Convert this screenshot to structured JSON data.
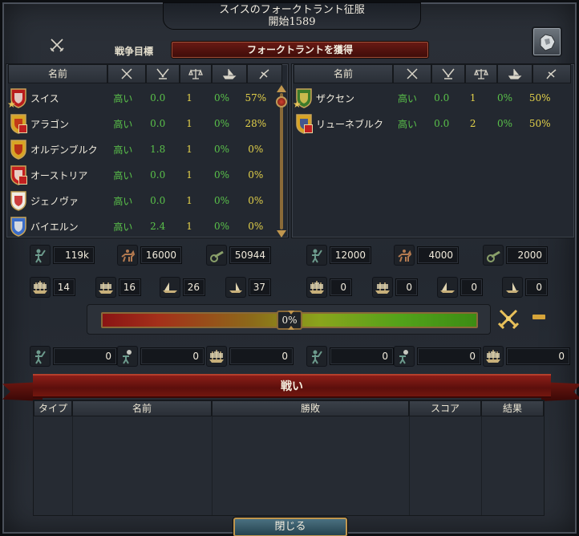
{
  "window": {
    "title": "スイスのフォークトラント征服",
    "subtitle": "開始1589"
  },
  "war_goal": {
    "label": "戦争目標",
    "value": "フォークトラントを獲得"
  },
  "table_header": {
    "name": "名前"
  },
  "attackers": [
    {
      "name": "スイス",
      "will": "高い",
      "war": "0.0",
      "balance": "1",
      "profit": "0%",
      "participation": "57%",
      "flag_colors": [
        "#b81c1c",
        "#e8e4dc"
      ],
      "badge": "star"
    },
    {
      "name": "アラゴン",
      "will": "高い",
      "war": "0.0",
      "balance": "1",
      "profit": "0%",
      "participation": "28%",
      "flag_colors": [
        "#d8a424",
        "#c02818"
      ],
      "badge": "red"
    },
    {
      "name": "オルデンブルク",
      "will": "高い",
      "war": "1.8",
      "balance": "1",
      "profit": "0%",
      "participation": "0%",
      "flag_colors": [
        "#d8a424",
        "#b01c14"
      ],
      "badge": ""
    },
    {
      "name": "オーストリア",
      "will": "高い",
      "war": "0.0",
      "balance": "1",
      "profit": "0%",
      "participation": "0%",
      "flag_colors": [
        "#c42020",
        "#f0ece4"
      ],
      "badge": "red"
    },
    {
      "name": "ジェノヴァ",
      "will": "高い",
      "war": "0.0",
      "balance": "1",
      "profit": "0%",
      "participation": "0%",
      "flag_colors": [
        "#f0ece4",
        "#c42020"
      ],
      "badge": ""
    },
    {
      "name": "バイエルン",
      "will": "高い",
      "war": "2.4",
      "balance": "1",
      "profit": "0%",
      "participation": "0%",
      "flag_colors": [
        "#3a6cc8",
        "#f0ece4"
      ],
      "badge": ""
    }
  ],
  "defenders": [
    {
      "name": "ザクセン",
      "will": "高い",
      "war": "0.0",
      "balance": "1",
      "profit": "0%",
      "participation": "50%",
      "flag_colors": [
        "#3c7a2a",
        "#e0c454"
      ],
      "badge": "star"
    },
    {
      "name": "リューネブルク",
      "will": "高い",
      "war": "0.0",
      "balance": "2",
      "profit": "0%",
      "participation": "50%",
      "flag_colors": [
        "#d8a424",
        "#2a4aa0"
      ],
      "badge": "red"
    }
  ],
  "attacker_forces": {
    "infantry": "119k",
    "cavalry": "16000",
    "artillery": "50944",
    "heavy_ships": "14",
    "light_ships": "16",
    "galleys": "26",
    "transports": "37"
  },
  "defender_forces": {
    "infantry": "12000",
    "cavalry": "4000",
    "artillery": "2000",
    "heavy_ships": "0",
    "light_ships": "0",
    "galleys": "0",
    "transports": "0"
  },
  "war_score": {
    "value": "0%",
    "fraction": 0.5
  },
  "attacker_losses": {
    "army": "0",
    "attrition": "0",
    "navy": "0"
  },
  "defender_losses": {
    "army": "0",
    "attrition": "0",
    "navy": "0"
  },
  "battles": {
    "title": "戦い",
    "columns": [
      "タイプ",
      "名前",
      "勝敗",
      "スコア",
      "結果"
    ]
  },
  "close_label": "閉じる",
  "colors": {
    "positive": "#5ac24a",
    "neutral": "#e4d24a",
    "war_goal_bg": "#6a1a14"
  }
}
